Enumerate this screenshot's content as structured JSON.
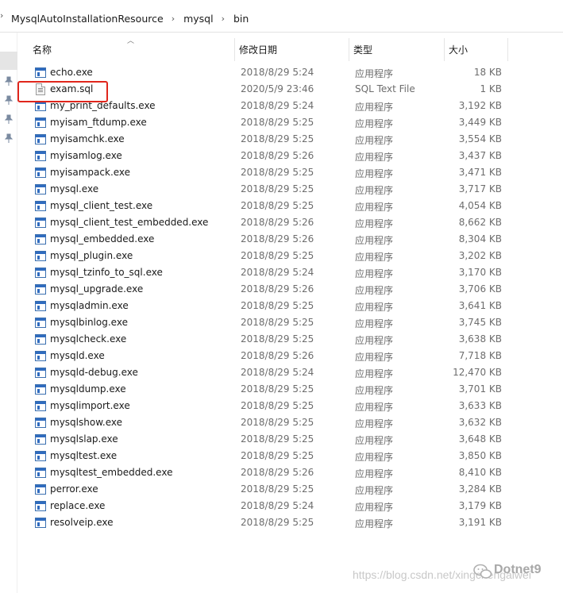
{
  "breadcrumb": {
    "items": [
      "MysqlAutoInstallationResource",
      "mysql",
      "bin"
    ]
  },
  "columns": {
    "name": "名称",
    "date": "修改日期",
    "type": "类型",
    "size": "大小"
  },
  "files": [
    {
      "name": "echo.exe",
      "date": "2018/8/29 5:24",
      "type": "应用程序",
      "size": "18 KB",
      "icon": "exe-icon"
    },
    {
      "name": "exam.sql",
      "date": "2020/5/9 23:46",
      "type": "SQL Text File",
      "size": "1 KB",
      "icon": "sql-file-icon"
    },
    {
      "name": "my_print_defaults.exe",
      "date": "2018/8/29 5:24",
      "type": "应用程序",
      "size": "3,192 KB",
      "icon": "exe-icon"
    },
    {
      "name": "myisam_ftdump.exe",
      "date": "2018/8/29 5:25",
      "type": "应用程序",
      "size": "3,449 KB",
      "icon": "exe-icon"
    },
    {
      "name": "myisamchk.exe",
      "date": "2018/8/29 5:25",
      "type": "应用程序",
      "size": "3,554 KB",
      "icon": "exe-icon"
    },
    {
      "name": "myisamlog.exe",
      "date": "2018/8/29 5:26",
      "type": "应用程序",
      "size": "3,437 KB",
      "icon": "exe-icon"
    },
    {
      "name": "myisampack.exe",
      "date": "2018/8/29 5:25",
      "type": "应用程序",
      "size": "3,471 KB",
      "icon": "exe-icon"
    },
    {
      "name": "mysql.exe",
      "date": "2018/8/29 5:25",
      "type": "应用程序",
      "size": "3,717 KB",
      "icon": "exe-icon"
    },
    {
      "name": "mysql_client_test.exe",
      "date": "2018/8/29 5:25",
      "type": "应用程序",
      "size": "4,054 KB",
      "icon": "exe-icon"
    },
    {
      "name": "mysql_client_test_embedded.exe",
      "date": "2018/8/29 5:26",
      "type": "应用程序",
      "size": "8,662 KB",
      "icon": "exe-icon"
    },
    {
      "name": "mysql_embedded.exe",
      "date": "2018/8/29 5:26",
      "type": "应用程序",
      "size": "8,304 KB",
      "icon": "exe-icon"
    },
    {
      "name": "mysql_plugin.exe",
      "date": "2018/8/29 5:25",
      "type": "应用程序",
      "size": "3,202 KB",
      "icon": "exe-icon"
    },
    {
      "name": "mysql_tzinfo_to_sql.exe",
      "date": "2018/8/29 5:24",
      "type": "应用程序",
      "size": "3,170 KB",
      "icon": "exe-icon"
    },
    {
      "name": "mysql_upgrade.exe",
      "date": "2018/8/29 5:26",
      "type": "应用程序",
      "size": "3,706 KB",
      "icon": "exe-icon"
    },
    {
      "name": "mysqladmin.exe",
      "date": "2018/8/29 5:25",
      "type": "应用程序",
      "size": "3,641 KB",
      "icon": "exe-icon"
    },
    {
      "name": "mysqlbinlog.exe",
      "date": "2018/8/29 5:25",
      "type": "应用程序",
      "size": "3,745 KB",
      "icon": "exe-icon"
    },
    {
      "name": "mysqlcheck.exe",
      "date": "2018/8/29 5:25",
      "type": "应用程序",
      "size": "3,638 KB",
      "icon": "exe-icon"
    },
    {
      "name": "mysqld.exe",
      "date": "2018/8/29 5:26",
      "type": "应用程序",
      "size": "7,718 KB",
      "icon": "exe-icon"
    },
    {
      "name": "mysqld-debug.exe",
      "date": "2018/8/29 5:24",
      "type": "应用程序",
      "size": "12,470 KB",
      "icon": "exe-icon"
    },
    {
      "name": "mysqldump.exe",
      "date": "2018/8/29 5:25",
      "type": "应用程序",
      "size": "3,701 KB",
      "icon": "exe-icon"
    },
    {
      "name": "mysqlimport.exe",
      "date": "2018/8/29 5:25",
      "type": "应用程序",
      "size": "3,633 KB",
      "icon": "exe-icon"
    },
    {
      "name": "mysqlshow.exe",
      "date": "2018/8/29 5:25",
      "type": "应用程序",
      "size": "3,632 KB",
      "icon": "exe-icon"
    },
    {
      "name": "mysqlslap.exe",
      "date": "2018/8/29 5:25",
      "type": "应用程序",
      "size": "3,648 KB",
      "icon": "exe-icon"
    },
    {
      "name": "mysqltest.exe",
      "date": "2018/8/29 5:25",
      "type": "应用程序",
      "size": "3,850 KB",
      "icon": "exe-icon"
    },
    {
      "name": "mysqltest_embedded.exe",
      "date": "2018/8/29 5:26",
      "type": "应用程序",
      "size": "8,410 KB",
      "icon": "exe-icon"
    },
    {
      "name": "perror.exe",
      "date": "2018/8/29 5:25",
      "type": "应用程序",
      "size": "3,284 KB",
      "icon": "exe-icon"
    },
    {
      "name": "replace.exe",
      "date": "2018/8/29 5:24",
      "type": "应用程序",
      "size": "3,179 KB",
      "icon": "exe-icon"
    },
    {
      "name": "resolveip.exe",
      "date": "2018/8/29 5:25",
      "type": "应用程序",
      "size": "3,191 KB",
      "icon": "exe-icon"
    }
  ],
  "highlight_color": "#e0261c",
  "watermark": {
    "url": "https://blog.csdn.net/xingchengaiwei",
    "brand": "Dotnet9"
  }
}
